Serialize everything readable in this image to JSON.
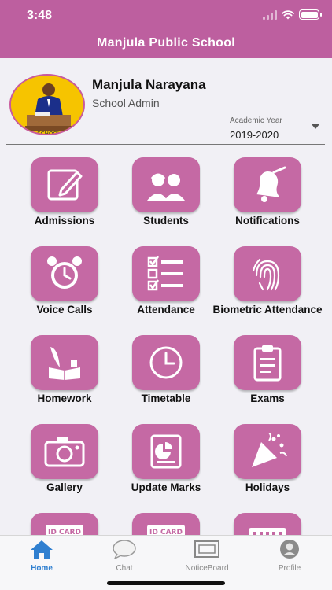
{
  "status": {
    "time": "3:48"
  },
  "header": {
    "title": "Manjula Public School"
  },
  "profile": {
    "name": "Manjula Narayana",
    "role": "School Admin",
    "academic_year_label": "Academic Year",
    "academic_year": "2019-2020"
  },
  "tiles": [
    {
      "label": "Admissions",
      "icon": "pencil-square-icon"
    },
    {
      "label": "Students",
      "icon": "students-icon"
    },
    {
      "label": "Notifications",
      "icon": "bell-icon"
    },
    {
      "label": "Voice Calls",
      "icon": "alarm-clock-icon"
    },
    {
      "label": "Attendance",
      "icon": "checklist-icon"
    },
    {
      "label": "Biometric Attendance",
      "icon": "fingerprint-icon"
    },
    {
      "label": "Homework",
      "icon": "quill-book-icon"
    },
    {
      "label": "Timetable",
      "icon": "clock-icon"
    },
    {
      "label": "Exams",
      "icon": "clipboard-icon"
    },
    {
      "label": "Gallery",
      "icon": "camera-icon"
    },
    {
      "label": "Update Marks",
      "icon": "report-icon"
    },
    {
      "label": "Holidays",
      "icon": "party-popper-icon"
    },
    {
      "label": "",
      "icon": "id-card-icon",
      "badge": "ID CARD"
    },
    {
      "label": "",
      "icon": "id-card-icon",
      "badge": "ID CARD"
    },
    {
      "label": "",
      "icon": "card-icon"
    }
  ],
  "tabbar": {
    "items": [
      {
        "label": "Home",
        "icon": "home-icon",
        "active": true
      },
      {
        "label": "Chat",
        "icon": "chat-icon",
        "active": false
      },
      {
        "label": "NoticeBoard",
        "icon": "noticeboard-icon",
        "active": false
      },
      {
        "label": "Profile",
        "icon": "profile-icon",
        "active": false
      }
    ]
  },
  "colors": {
    "brand": "#bd5f9f",
    "tile": "#c569a4",
    "active_tab": "#2f7fd0"
  }
}
